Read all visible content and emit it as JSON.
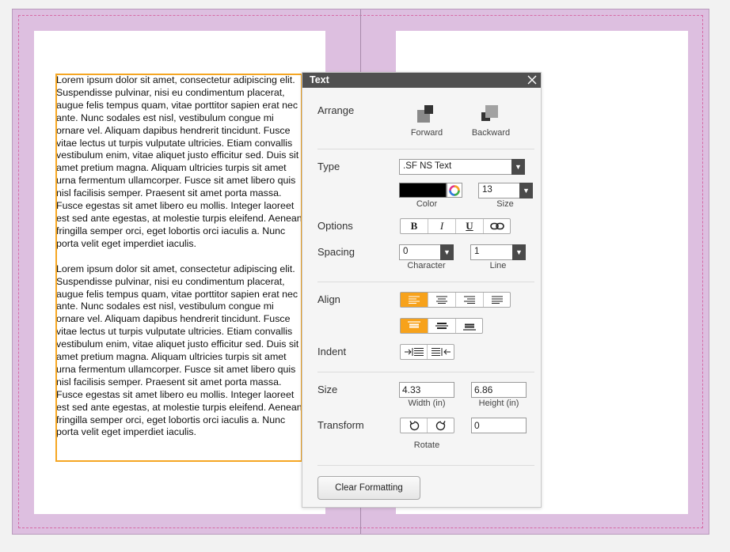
{
  "document": {
    "paragraphs": [
      "Lorem ipsum dolor sit amet, consectetur adipiscing elit. Suspendisse pulvinar, nisi eu condimentum placerat, augue felis tempus quam, vitae porttitor sapien erat nec ante. Nunc sodales est nisl, vestibulum congue mi ornare vel. Aliquam dapibus hendrerit tincidunt. Fusce vitae lectus ut turpis vulputate ultricies. Etiam convallis vestibulum enim, vitae aliquet justo efficitur sed. Duis sit amet pretium magna. Aliquam ultricies turpis sit amet urna fermentum ullamcorper. Fusce sit amet libero quis nisl facilisis semper. Praesent sit amet porta massa. Fusce egestas sit amet libero eu mollis. Integer laoreet est sed ante egestas, at molestie turpis eleifend. Aenean fringilla semper orci, eget lobortis orci iaculis a. Nunc porta velit eget imperdiet iaculis.",
      "Lorem ipsum dolor sit amet, consectetur adipiscing elit. Suspendisse pulvinar, nisi eu condimentum placerat, augue felis tempus quam, vitae porttitor sapien erat nec ante. Nunc sodales est nisl, vestibulum congue mi ornare vel. Aliquam dapibus hendrerit tincidunt. Fusce vitae lectus ut turpis vulputate ultricies. Etiam convallis vestibulum enim, vitae aliquet justo efficitur sed. Duis sit amet pretium magna. Aliquam ultricies turpis sit amet urna fermentum ullamcorper. Fusce sit amet libero quis nisl facilisis semper. Praesent sit amet porta massa. Fusce egestas sit amet libero eu mollis. Integer laoreet est sed ante egestas, at molestie turpis eleifend. Aenean fringilla semper orci, eget lobortis orci iaculis a. Nunc porta velit eget imperdiet iaculis."
    ]
  },
  "panel": {
    "title": "Text",
    "close_icon": "close-icon",
    "arrange": {
      "label": "Arrange",
      "forward_label": "Forward",
      "backward_label": "Backward"
    },
    "type": {
      "label": "Type",
      "font_value": ".SF NS Text",
      "color_label": "Color",
      "color_value": "#000000",
      "size_label": "Size",
      "size_value": "13"
    },
    "options": {
      "label": "Options",
      "bold": "B",
      "italic": "I",
      "underline": "U",
      "link_icon": "link-icon"
    },
    "spacing": {
      "label": "Spacing",
      "character_value": "0",
      "character_label": "Character",
      "line_value": "1",
      "line_label": "Line"
    },
    "align": {
      "label": "Align",
      "horizontal": [
        "align-left",
        "align-center",
        "align-right",
        "align-justify"
      ],
      "horizontal_selected": 0,
      "vertical": [
        "align-top",
        "align-middle",
        "align-bottom"
      ],
      "vertical_selected": 0
    },
    "indent": {
      "label": "Indent",
      "buttons": [
        "indent-increase",
        "indent-decrease"
      ]
    },
    "size": {
      "label": "Size",
      "width_value": "4.33",
      "width_label": "Width (in)",
      "height_value": "6.86",
      "height_label": "Height (in)"
    },
    "transform": {
      "label": "Transform",
      "rotate_label": "Rotate",
      "rotate_value": "0"
    },
    "clear_formatting_label": "Clear Formatting"
  },
  "colors": {
    "accent": "#f7a21b",
    "spread": "#ddbfe0",
    "frame": "#f5a623",
    "panel_header": "#505050"
  }
}
